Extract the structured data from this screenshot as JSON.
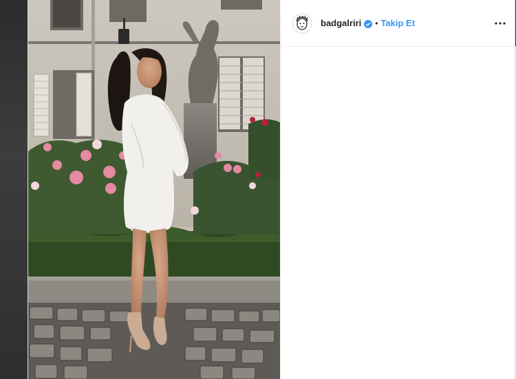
{
  "post": {
    "username": "badgalriri",
    "separator": "•",
    "follow_label": "Takip Et",
    "verified": true
  },
  "icons": {
    "avatar": "avatar-face-icon",
    "verified": "verified-badge-icon",
    "more": "more-options-icon"
  },
  "colors": {
    "link": "#3897f0",
    "verified": "#3897f0",
    "text": "#262626",
    "border": "#efefef"
  }
}
